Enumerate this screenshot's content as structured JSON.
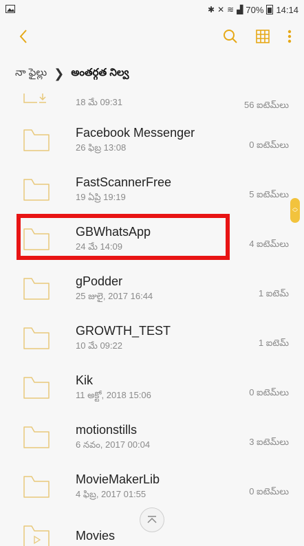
{
  "status_bar": {
    "battery_percent": "70%",
    "time": "14:14",
    "signal_icons": [
      "bluetooth-icon",
      "mute-icon",
      "wifi-icon",
      "signal-icon"
    ]
  },
  "toolbar": {
    "back_icon": "chevron-left-icon",
    "search_icon": "search-icon",
    "grid_icon": "grid-icon",
    "more_icon": "more-vertical-icon",
    "accent_color": "#e6a817"
  },
  "breadcrumb": {
    "root": "నా ఫైల్లు",
    "separator": "❯",
    "current": "అంతర్గత నిల్వ"
  },
  "files": [
    {
      "name": "",
      "date": "18 మే 09:31",
      "count": "56 ఐటెమ్‌లు"
    },
    {
      "name": "Facebook Messenger",
      "date": "26 ఫిబ్ర 13:08",
      "count": "0 ఐటెమ్‌లు"
    },
    {
      "name": "FastScannerFree",
      "date": "19 ఏప్రి 19:19",
      "count": "5 ఐటెమ్‌లు"
    },
    {
      "name": "GBWhatsApp",
      "date": "24 మే 14:09",
      "count": "4 ఐటెమ్‌లు"
    },
    {
      "name": "gPodder",
      "date": "25 జులై, 2017 16:44",
      "count": "1 ఐటెమ్"
    },
    {
      "name": "GROWTH_TEST",
      "date": "10 మే 09:22",
      "count": "1 ఐటెమ్"
    },
    {
      "name": "Kik",
      "date": "11 అక్టో, 2018 15:06",
      "count": "0 ఐటెమ్‌లు"
    },
    {
      "name": "motionstills",
      "date": "6 నవం, 2017 00:04",
      "count": "3 ఐటెమ్‌లు"
    },
    {
      "name": "MovieMakerLib",
      "date": "4 ఫిబ్ర, 2017 01:55",
      "count": "0 ఐటెమ్‌లు"
    },
    {
      "name": "Movies",
      "date": "",
      "count": ""
    }
  ],
  "highlight_color": "#e81414"
}
